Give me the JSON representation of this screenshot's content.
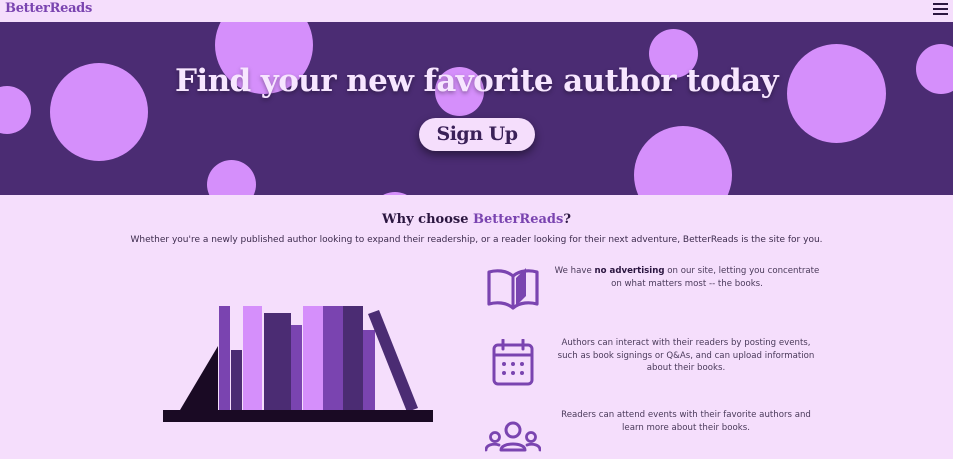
{
  "nav": {
    "logo": "BetterReads",
    "menu_icon": "hamburger-menu-icon"
  },
  "hero": {
    "title": "Find your new favorite author today",
    "signup_label": "Sign Up"
  },
  "why": {
    "prefix": "Why choose ",
    "brand": "BetterReads",
    "suffix": "?",
    "subtitle": "Whether you're a newly published author looking to expand their readership, or a reader looking for their next adventure, BetterReads is the site for you."
  },
  "features": [
    {
      "icon": "open-book-icon",
      "text_before": "We have ",
      "text_bold": "no advertising",
      "text_after": " on our site, letting you concentrate on what matters most -- the books."
    },
    {
      "icon": "calendar-icon",
      "text": "Authors can interact with their readers by posting events, such as book signings or Q&As, and can upload information about their books."
    },
    {
      "icon": "users-group-icon",
      "text": "Readers can attend events with their favorite authors and learn more about their books."
    }
  ],
  "colors": {
    "background": "#f5defc",
    "hero": "#4b2c73",
    "bubble": "#d58ffb",
    "accent": "#7a44b0",
    "dark": "#2b1640"
  }
}
